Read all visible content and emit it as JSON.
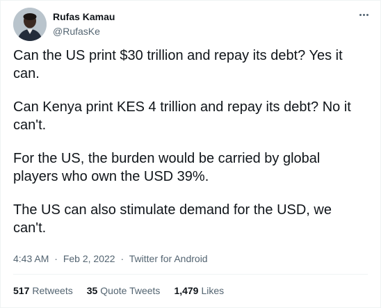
{
  "author": {
    "display_name": "Rufas Kamau",
    "handle": "@RufasKe"
  },
  "tweet": {
    "paragraphs": [
      "Can the US print $30 trillion and repay its debt? Yes it can.",
      "Can Kenya print KES 4 trillion and repay its debt? No it can't.",
      "For the US, the burden would be carried by global players who own the USD 39%.",
      "The US can also stimulate demand for the USD, we can't."
    ],
    "time": "4:43 AM",
    "date": "Feb 2, 2022",
    "separator": "·",
    "source": "Twitter for Android"
  },
  "stats": {
    "retweets_count": "517",
    "retweets_label": "Retweets",
    "quotes_count": "35",
    "quotes_label": "Quote Tweets",
    "likes_count": "1,479",
    "likes_label": "Likes"
  },
  "icons": {
    "more": "more-horizontal-icon"
  },
  "colors": {
    "text": "#0f1419",
    "secondary": "#536471",
    "border": "#eff3f4"
  }
}
